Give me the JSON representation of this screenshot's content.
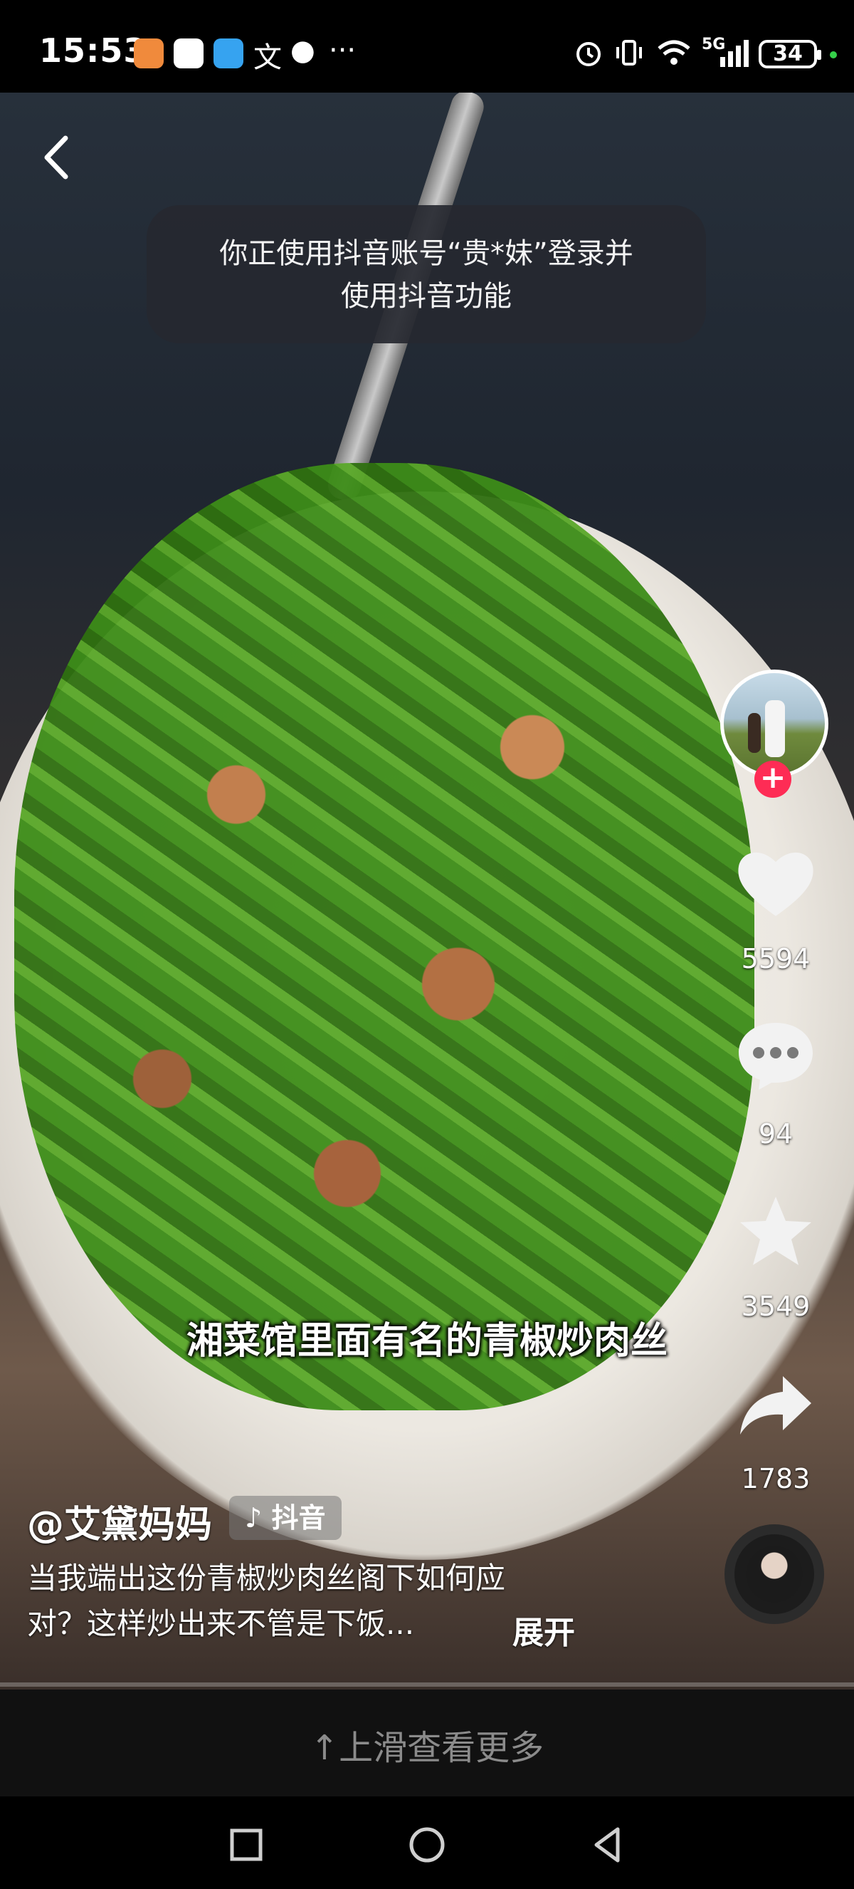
{
  "status_bar": {
    "time": "15:53",
    "network_label": "5G",
    "battery": "34"
  },
  "toast": {
    "line1": "你正使用抖音账号“贵*妹”登录并",
    "line2": "使用抖音功能"
  },
  "subtitle": "湘菜馆里面有名的青椒炒肉丝",
  "actions": {
    "likes": "5594",
    "comments": "94",
    "favorites": "3549",
    "shares": "1783"
  },
  "caption": {
    "author": "@艾黛妈妈",
    "tag_label": "抖音",
    "line1": "当我端出这份青椒炒肉丝阁下如何应",
    "line2": "对？这样炒出来不管是下饭...",
    "expand": "展开"
  },
  "swipe_hint": "上滑查看更多",
  "colors": {
    "follow_accent": "#fe2c55",
    "background": "#000000"
  }
}
